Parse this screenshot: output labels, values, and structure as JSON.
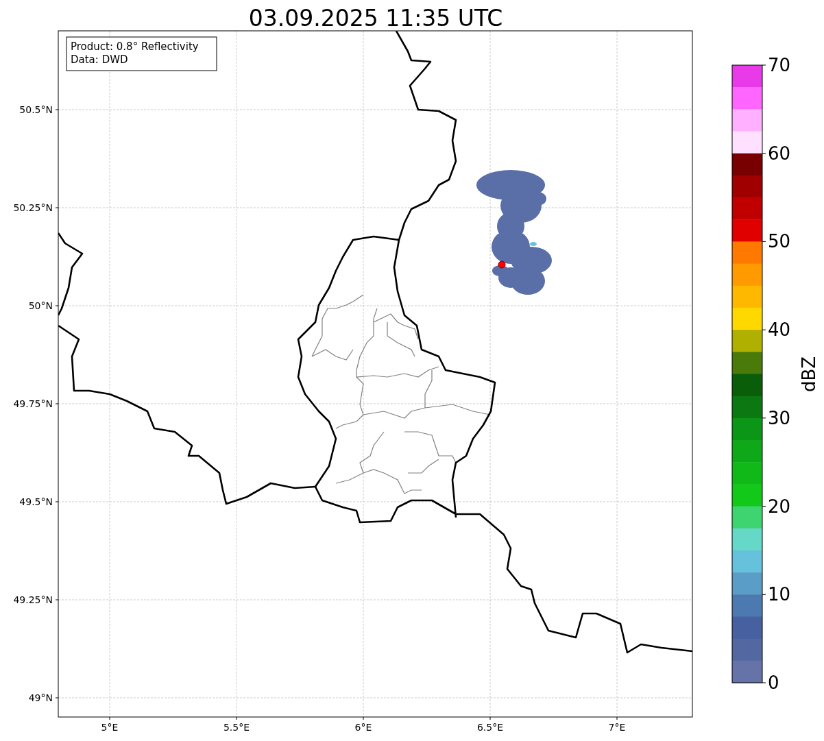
{
  "title": "03.09.2025 11:35 UTC",
  "info_box": {
    "lines": [
      "Product: 0.8° Reflectivity",
      "Data: DWD"
    ]
  },
  "map": {
    "lat_ticks": [
      "50.5°N",
      "50.25°N",
      "50°N",
      "49.75°N",
      "49.5°N",
      "49.25°N",
      "49°N"
    ],
    "lon_ticks": [
      "5°E",
      "5.5°E",
      "6°E",
      "6.5°E",
      "7°E"
    ]
  },
  "colorbar": {
    "label": "dBZ",
    "ticks": [
      "70",
      "60",
      "50",
      "40",
      "30",
      "20",
      "10",
      "0"
    ],
    "bands": [
      {
        "color": "#e83ae8"
      },
      {
        "color": "#ff66ff"
      },
      {
        "color": "#ffb0ff"
      },
      {
        "color": "#ffe0ff"
      },
      {
        "color": "#780000"
      },
      {
        "color": "#a00000"
      },
      {
        "color": "#c00000"
      },
      {
        "color": "#e00000"
      },
      {
        "color": "#ff7800"
      },
      {
        "color": "#ff9a00"
      },
      {
        "color": "#ffb800"
      },
      {
        "color": "#ffd800"
      },
      {
        "color": "#b0b000"
      },
      {
        "color": "#4a7a0a"
      },
      {
        "color": "#0a5e0a"
      },
      {
        "color": "#0c7812"
      },
      {
        "color": "#0c9618"
      },
      {
        "color": "#0ea818"
      },
      {
        "color": "#10b818"
      },
      {
        "color": "#12c818"
      },
      {
        "color": "#3ed470"
      },
      {
        "color": "#66d8c8"
      },
      {
        "color": "#66c2dc"
      },
      {
        "color": "#5a9ec8"
      },
      {
        "color": "#4c7ab0"
      },
      {
        "color": "#4660a0"
      },
      {
        "color": "#5368a0"
      },
      {
        "color": "#6673a8"
      }
    ]
  }
}
